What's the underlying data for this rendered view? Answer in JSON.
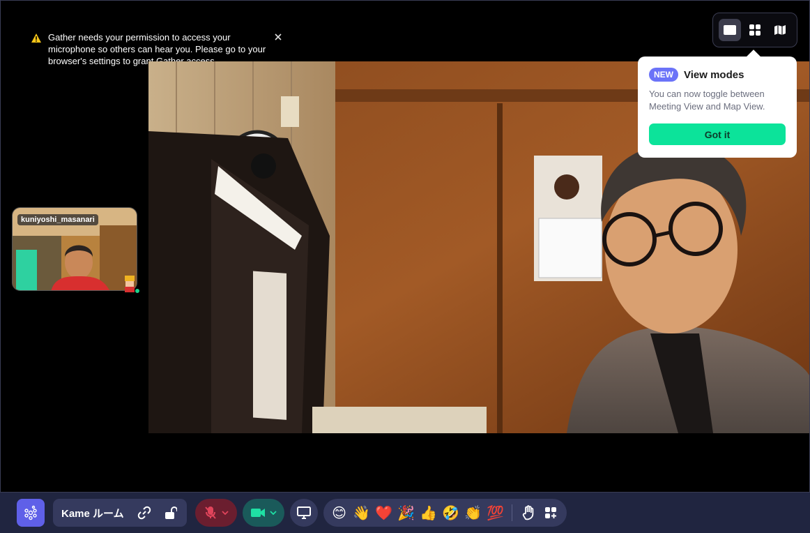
{
  "warning": {
    "text": "Gather needs your permission to access your microphone so others can hear you. Please go to your browser's settings to grant Gather access."
  },
  "view_modes": {
    "options": [
      "meeting-view",
      "grid-view",
      "map-view"
    ],
    "active": "meeting-view"
  },
  "popover": {
    "badge": "NEW",
    "title": "View modes",
    "body": "You can now toggle between Meeting View and Map View.",
    "button": "Got it"
  },
  "participant": {
    "name": "kuniyoshi_masanari",
    "status_color": "#1fd28e"
  },
  "toolbar": {
    "room_name": "Kame ルーム",
    "emojis": [
      "😊",
      "👋",
      "❤️",
      "🎉",
      "👍",
      "🤣",
      "👏",
      "💯"
    ]
  },
  "colors": {
    "accent": "#5f60e8",
    "cta": "#0ce39a",
    "mic_off": "#6b1e2f",
    "camera_on": "#1a5a5a"
  }
}
